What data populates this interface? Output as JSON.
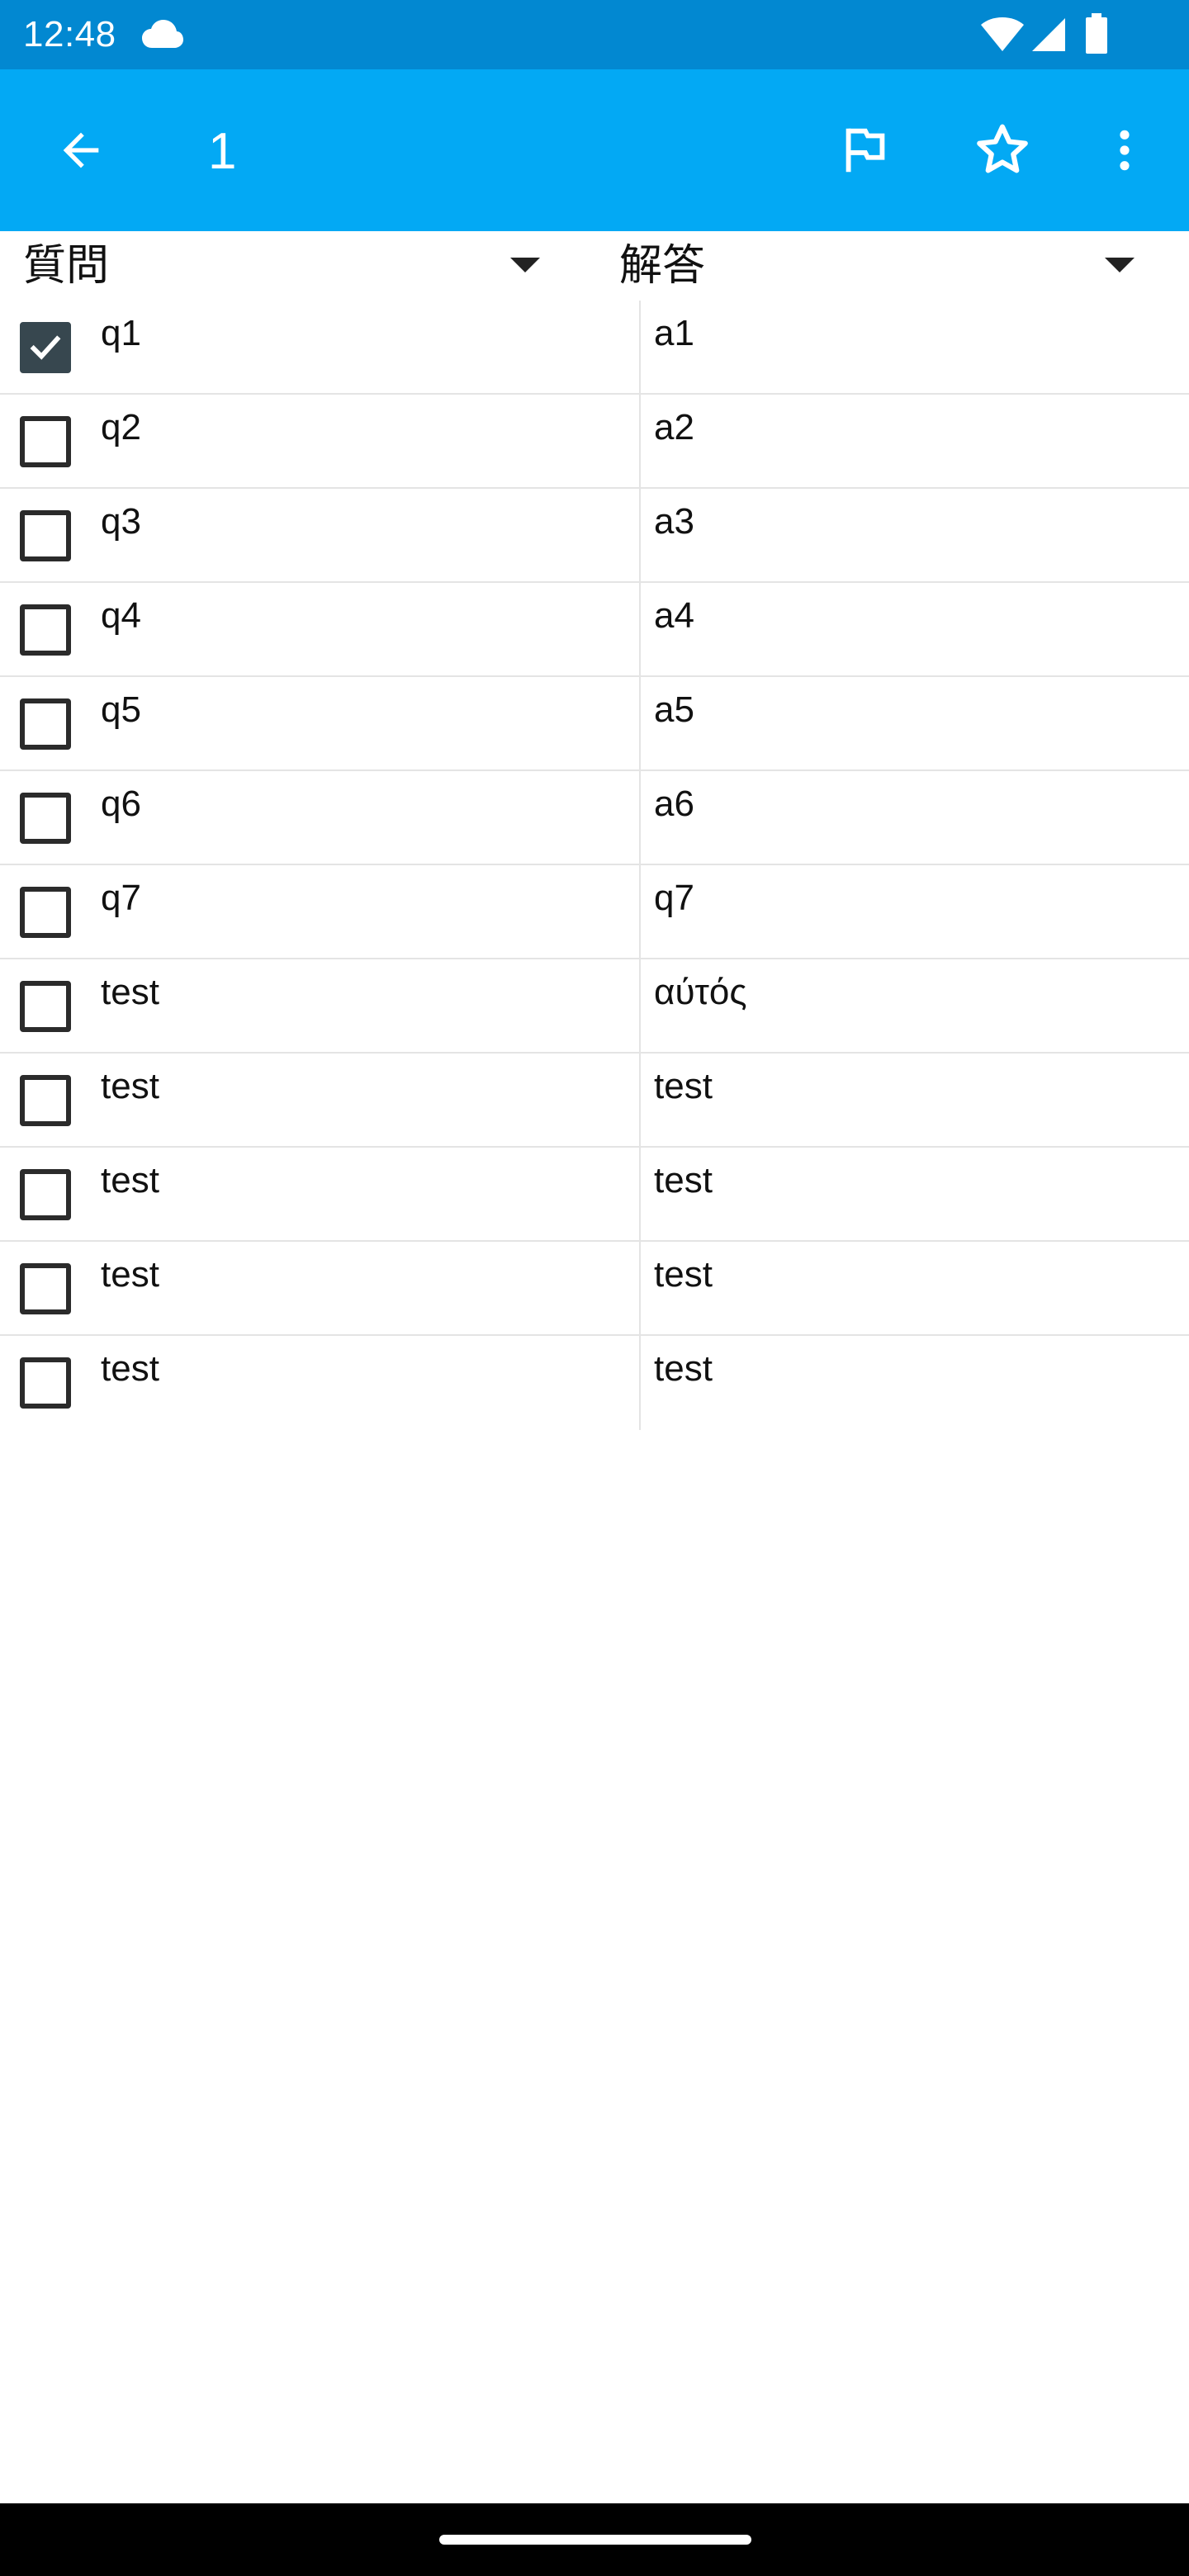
{
  "status_bar": {
    "time": "12:48",
    "icons": [
      "cloud-icon",
      "wifi-icon",
      "signal-icon",
      "battery-icon"
    ]
  },
  "app_bar": {
    "title": "1",
    "back_icon": "arrow-left-icon",
    "flag_icon": "flag-outline-icon",
    "star_icon": "star-outline-icon",
    "more_icon": "more-vert-icon"
  },
  "columns": {
    "question": "質問",
    "answer": "解答"
  },
  "rows": [
    {
      "q": "q1",
      "a": "a1",
      "checked": true
    },
    {
      "q": "q2",
      "a": "a2",
      "checked": false
    },
    {
      "q": "q3",
      "a": "a3",
      "checked": false
    },
    {
      "q": "q4",
      "a": "a4",
      "checked": false
    },
    {
      "q": "q5",
      "a": "a5",
      "checked": false
    },
    {
      "q": "q6",
      "a": "a6",
      "checked": false
    },
    {
      "q": "q7",
      "a": "q7",
      "checked": false
    },
    {
      "q": "test",
      "a": "αύτός",
      "checked": false
    },
    {
      "q": "test",
      "a": "test",
      "checked": false
    },
    {
      "q": "test",
      "a": "test",
      "checked": false
    },
    {
      "q": "test",
      "a": "test",
      "checked": false
    },
    {
      "q": "test",
      "a": "test",
      "checked": false
    }
  ],
  "colors": {
    "status_bar": "#0288d1",
    "app_bar": "#03a9f4",
    "checkbox_checked": "#37474f",
    "divider": "#e4e4e4"
  }
}
